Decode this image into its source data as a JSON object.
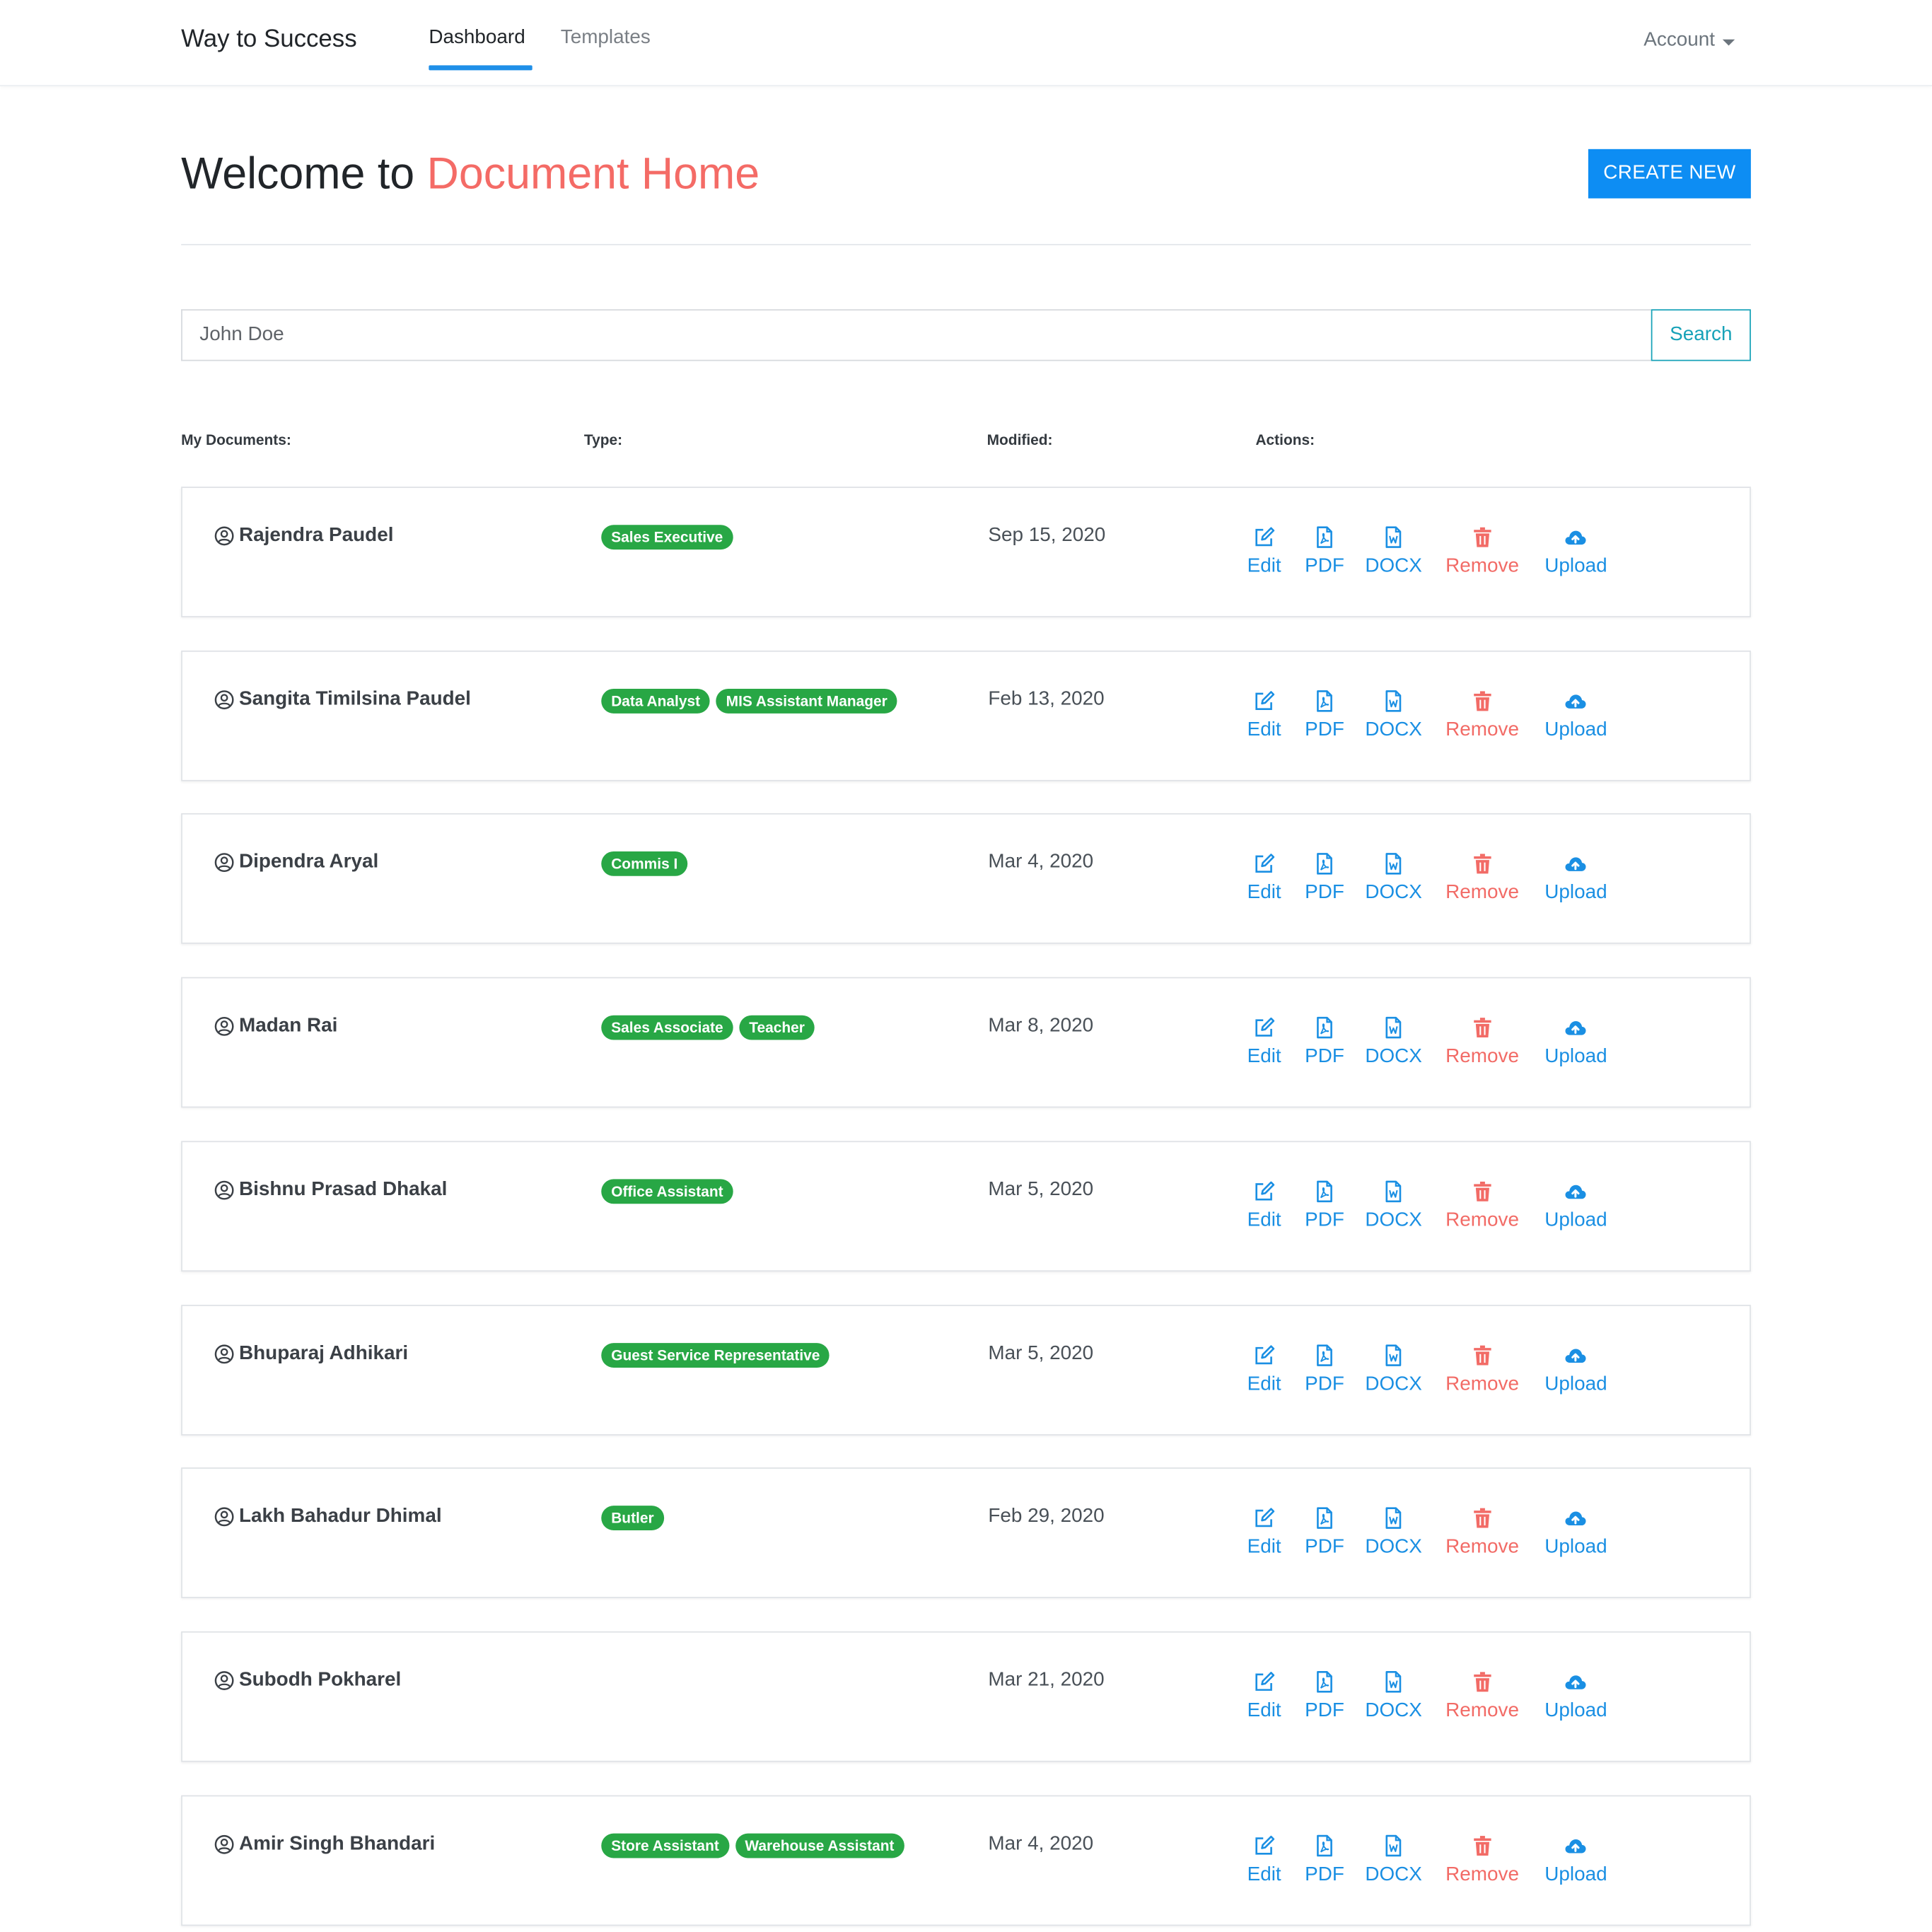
{
  "navbar": {
    "brand": "Way to Success",
    "links": [
      "Dashboard",
      "Templates"
    ],
    "active": "Dashboard",
    "account_label": "Account"
  },
  "header": {
    "welcome_prefix": "Welcome to ",
    "welcome_accent": "Document Home",
    "create_label": "CREATE NEW"
  },
  "search": {
    "value": "John Doe",
    "button_label": "Search"
  },
  "columns": {
    "documents": "My Documents:",
    "type": "Type:",
    "modified": "Modified:",
    "actions": "Actions:"
  },
  "actions": {
    "edit": "Edit",
    "pdf": "PDF",
    "docx": "DOCX",
    "remove": "Remove",
    "upload": "Upload"
  },
  "documents": [
    {
      "name": "Rajendra Paudel",
      "tags": [
        "Sales Executive"
      ],
      "modified": "Sep 15, 2020"
    },
    {
      "name": "Sangita Timilsina Paudel",
      "tags": [
        "Data Analyst",
        "MIS Assistant Manager"
      ],
      "modified": "Feb 13, 2020"
    },
    {
      "name": "Dipendra Aryal",
      "tags": [
        "Commis I"
      ],
      "modified": "Mar 4, 2020"
    },
    {
      "name": "Madan Rai",
      "tags": [
        "Sales Associate",
        "Teacher"
      ],
      "modified": "Mar 8, 2020"
    },
    {
      "name": "Bishnu Prasad Dhakal",
      "tags": [
        "Office Assistant"
      ],
      "modified": "Mar 5, 2020"
    },
    {
      "name": "Bhuparaj Adhikari",
      "tags": [
        "Guest Service Representative"
      ],
      "modified": "Mar 5, 2020"
    },
    {
      "name": "Lakh Bahadur Dhimal",
      "tags": [
        "Butler"
      ],
      "modified": "Feb 29, 2020"
    },
    {
      "name": "Subodh Pokharel",
      "tags": [],
      "modified": "Mar 21, 2020"
    },
    {
      "name": "Amir Singh Bhandari",
      "tags": [
        "Store Assistant",
        "Warehouse Assistant"
      ],
      "modified": "Mar 4, 2020"
    }
  ],
  "colors": {
    "primary": "#0d8df3",
    "accent": "#f46b66",
    "tag_green": "#28a745",
    "search_teal": "#17a2b8",
    "action_blue": "#1a8fe3",
    "remove_red": "#f26b66"
  }
}
